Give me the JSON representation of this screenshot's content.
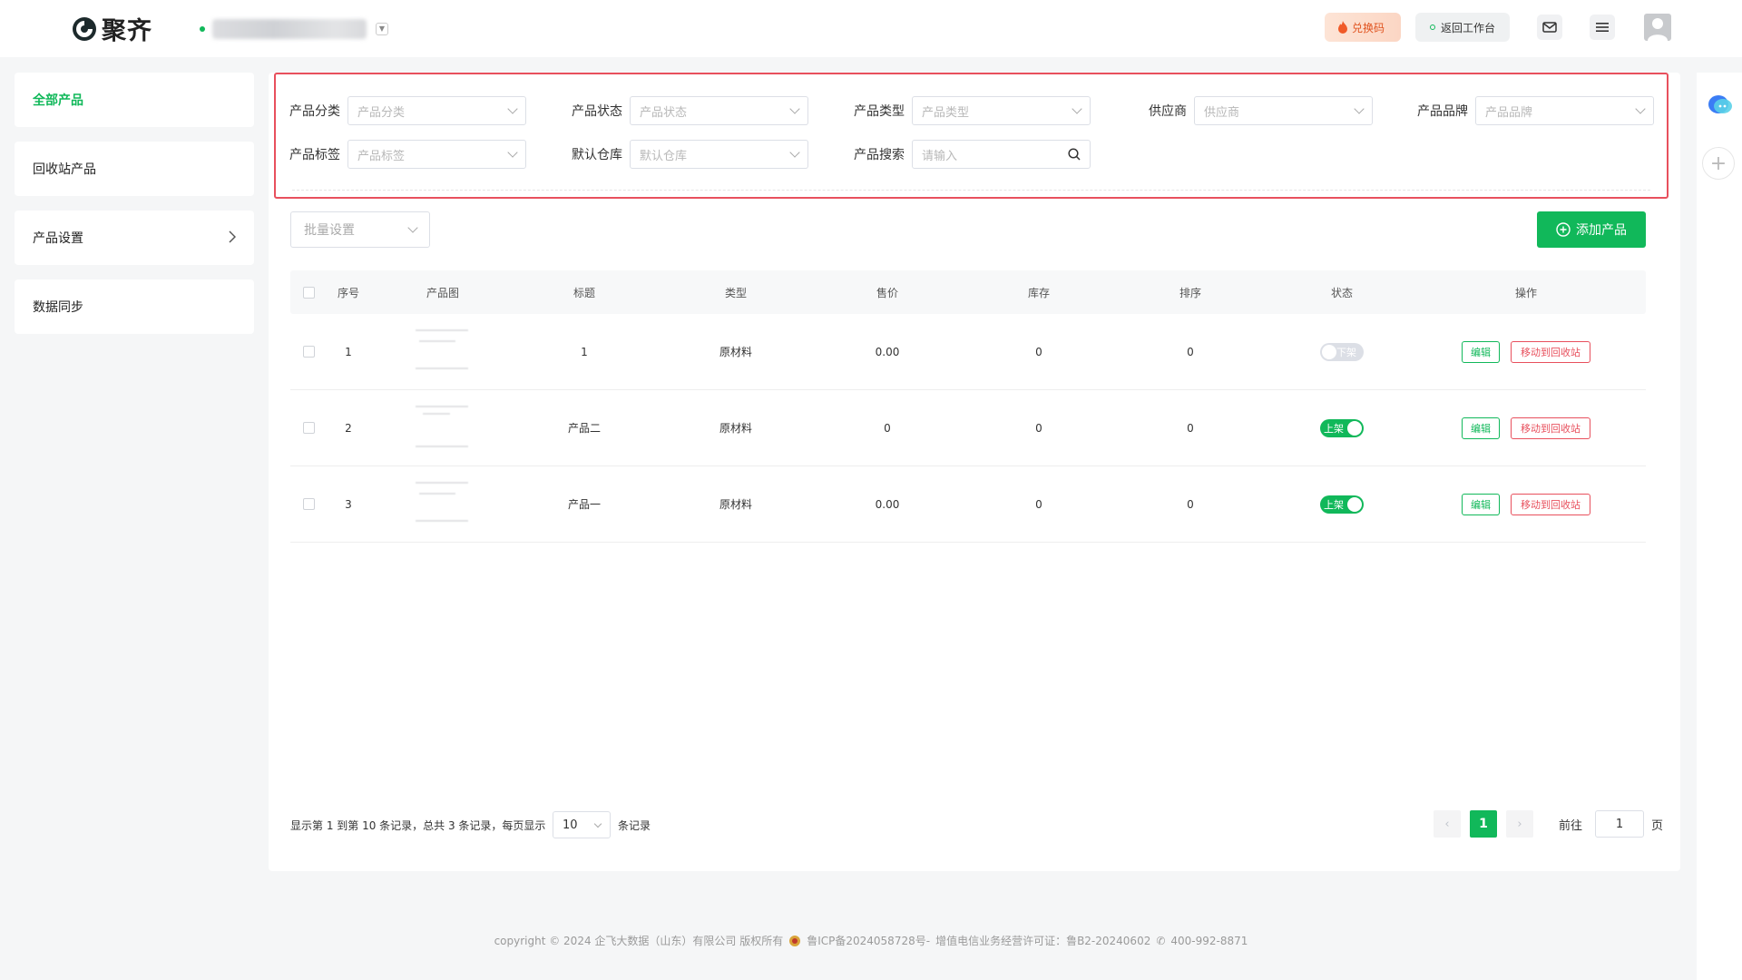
{
  "header": {
    "brand": "聚齐",
    "org_name": "",
    "redeem_label": "兑换码",
    "back_label": "返回工作台",
    "icons": [
      "mail-icon",
      "menu-icon",
      "avatar"
    ]
  },
  "sidebar": {
    "items": [
      {
        "label": "全部产品",
        "active": true
      },
      {
        "label": "回收站产品",
        "active": false
      },
      {
        "label": "产品设置",
        "active": false
      },
      {
        "label": "数据同步",
        "active": false
      }
    ]
  },
  "filters": {
    "category": {
      "label": "产品分类",
      "placeholder": "产品分类"
    },
    "status": {
      "label": "产品状态",
      "placeholder": "产品状态"
    },
    "type": {
      "label": "产品类型",
      "placeholder": "产品类型"
    },
    "supplier": {
      "label": "供应商",
      "placeholder": "供应商"
    },
    "brand": {
      "label": "产品品牌",
      "placeholder": "产品品牌"
    },
    "tag": {
      "label": "产品标签",
      "placeholder": "产品标签"
    },
    "warehouse": {
      "label": "默认仓库",
      "placeholder": "默认仓库"
    },
    "search": {
      "label": "产品搜索",
      "placeholder": "请输入"
    }
  },
  "toolbar": {
    "batch_placeholder": "批量设置",
    "add_label": "添加产品"
  },
  "table": {
    "headers": {
      "index": "序号",
      "image": "产品图",
      "title": "标题",
      "type": "类型",
      "price": "售价",
      "stock": "库存",
      "sort": "排序",
      "status": "状态",
      "ops": "操作"
    },
    "rows": [
      {
        "index": "1",
        "title": "1",
        "type": "原材料",
        "price": "0.00",
        "stock": "0",
        "sort": "0",
        "status": "下架",
        "on": false,
        "edit": "编辑",
        "recycle": "移动到回收站"
      },
      {
        "index": "2",
        "title": "产品二",
        "type": "原材料",
        "price": "0",
        "stock": "0",
        "sort": "0",
        "status": "上架",
        "on": true,
        "edit": "编辑",
        "recycle": "移动到回收站"
      },
      {
        "index": "3",
        "title": "产品一",
        "type": "原材料",
        "price": "0.00",
        "stock": "0",
        "sort": "0",
        "status": "上架",
        "on": true,
        "edit": "编辑",
        "recycle": "移动到回收站"
      }
    ]
  },
  "pagination": {
    "info": "显示第 1 到第 10 条记录，总共 3 条记录，每页显示",
    "page_size": "10",
    "suffix": "条记录",
    "current": "1",
    "goto_label": "前往",
    "goto_value": "1",
    "page_label": "页"
  },
  "footer": {
    "copyright": "copyright © 2024 企飞大数据（山东）有限公司 版权所有",
    "icp": "鲁ICP备2024058728号-",
    "license": "增值电信业务经营许可证：鲁B2-20240602",
    "phone": "400-992-8871"
  },
  "colors": {
    "accent": "#11b85a",
    "danger": "#e8505d"
  }
}
